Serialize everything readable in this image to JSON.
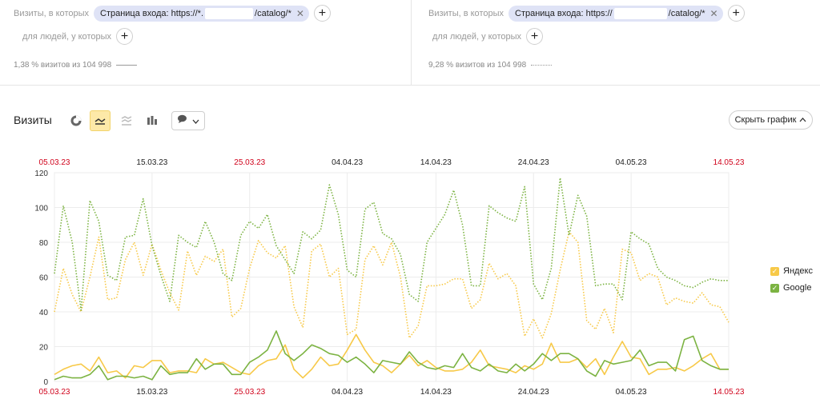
{
  "segments": [
    {
      "label_visits": "Визиты, в которых",
      "chip_prefix": "Страница входа: https://*.",
      "chip_suffix": "/catalog/*",
      "label_people": "для людей, у которых",
      "pct_text": "1,38 % визитов из 104 998"
    },
    {
      "label_visits": "Визиты, в которых",
      "chip_prefix": "Страница входа: https://",
      "chip_suffix": "/catalog/*",
      "label_people": "для людей, у которых",
      "pct_text": "9,28 % визитов из 104 998"
    }
  ],
  "toolbar": {
    "title": "Визиты",
    "hide_label": "Скрыть график"
  },
  "colors": {
    "yandex": "#f7c948",
    "google": "#7cb342",
    "accent_active": "#fde9a8",
    "weekend_red": "#d0021b"
  },
  "chart_data": {
    "type": "line",
    "ylim": [
      0,
      120
    ],
    "yticks": [
      0,
      20,
      40,
      60,
      80,
      100,
      120
    ],
    "date_start": "05.03.23",
    "date_end": "14.05.23",
    "top_ticks": [
      {
        "label": "05.03.23",
        "red": true
      },
      {
        "label": "15.03.23",
        "red": false
      },
      {
        "label": "25.03.23",
        "red": true
      },
      {
        "label": "04.04.23",
        "red": false
      },
      {
        "label": "14.04.23",
        "red": false
      },
      {
        "label": "24.04.23",
        "red": false
      },
      {
        "label": "04.05.23",
        "red": false
      },
      {
        "label": "14.05.23",
        "red": true
      }
    ],
    "bottom_ticks": [
      {
        "label": "05.03.23",
        "red": true
      },
      {
        "label": "15.03.23",
        "red": false
      },
      {
        "label": "25.03.23",
        "red": true
      },
      {
        "label": "04.04.23",
        "red": false
      },
      {
        "label": "14.04.23",
        "red": false
      },
      {
        "label": "24.04.23",
        "red": false
      },
      {
        "label": "04.05.23",
        "red": false
      },
      {
        "label": "14.05.23",
        "red": true
      }
    ],
    "legend": [
      {
        "name": "Яндекс",
        "color": "#f7c948"
      },
      {
        "name": "Google",
        "color": "#7cb342"
      }
    ],
    "series": [
      {
        "name": "Яндекс",
        "segment": 1,
        "style": "solid",
        "color": "#f7c948",
        "values": [
          4,
          7,
          9,
          10,
          6,
          14,
          5,
          6,
          2,
          9,
          8,
          12,
          12,
          5,
          6,
          6,
          5,
          13,
          10,
          11,
          8,
          5,
          4,
          9,
          12,
          13,
          21,
          7,
          2,
          7,
          14,
          9,
          10,
          18,
          27,
          18,
          11,
          9,
          5,
          10,
          15,
          9,
          12,
          8,
          6,
          6,
          7,
          11,
          18,
          9,
          8,
          7,
          5,
          9,
          7,
          10,
          22,
          11,
          11,
          13,
          8,
          13,
          4,
          14,
          23,
          14,
          13,
          4,
          7,
          7,
          8,
          6,
          9,
          13,
          16,
          7,
          7
        ]
      },
      {
        "name": "Google",
        "segment": 1,
        "style": "solid",
        "color": "#7cb342",
        "values": [
          1,
          3,
          2,
          2,
          4,
          9,
          1,
          3,
          3,
          2,
          3,
          1,
          9,
          4,
          5,
          5,
          13,
          7,
          10,
          10,
          4,
          4,
          11,
          14,
          18,
          29,
          16,
          12,
          16,
          21,
          19,
          16,
          15,
          11,
          14,
          10,
          5,
          12,
          11,
          10,
          17,
          11,
          8,
          7,
          9,
          8,
          16,
          8,
          6,
          10,
          6,
          5,
          10,
          6,
          10,
          16,
          12,
          16,
          16,
          13,
          6,
          3,
          12,
          10,
          11,
          12,
          18,
          9,
          11,
          11,
          6,
          24,
          26,
          12,
          9,
          7,
          7
        ]
      },
      {
        "name": "Яндекс",
        "segment": 2,
        "style": "dotted",
        "color": "#f7c948",
        "values": [
          40,
          65,
          50,
          40,
          60,
          83,
          47,
          48,
          70,
          80,
          61,
          79,
          64,
          51,
          41,
          75,
          61,
          72,
          69,
          76,
          37,
          42,
          65,
          81,
          74,
          71,
          78,
          43,
          31,
          75,
          79,
          60,
          65,
          27,
          30,
          70,
          78,
          67,
          80,
          60,
          25,
          32,
          55,
          55,
          56,
          59,
          59,
          42,
          47,
          68,
          59,
          62,
          55,
          26,
          36,
          25,
          39,
          64,
          86,
          80,
          35,
          30,
          42,
          28,
          76,
          74,
          58,
          62,
          60,
          44,
          48,
          46,
          45,
          51,
          44,
          43,
          34
        ]
      },
      {
        "name": "Google",
        "segment": 2,
        "style": "dotted",
        "color": "#7cb342",
        "values": [
          62,
          101,
          80,
          41,
          104,
          92,
          61,
          58,
          83,
          84,
          105,
          78,
          61,
          46,
          84,
          80,
          77,
          92,
          80,
          62,
          58,
          84,
          92,
          88,
          96,
          78,
          70,
          62,
          86,
          82,
          87,
          113,
          96,
          64,
          60,
          99,
          103,
          85,
          82,
          73,
          50,
          46,
          80,
          88,
          96,
          110,
          90,
          55,
          55,
          101,
          97,
          94,
          92,
          112,
          56,
          47,
          65,
          117,
          84,
          107,
          95,
          55,
          56,
          56,
          47,
          86,
          82,
          79,
          65,
          60,
          58,
          55,
          54,
          57,
          59,
          58,
          58
        ]
      }
    ]
  }
}
